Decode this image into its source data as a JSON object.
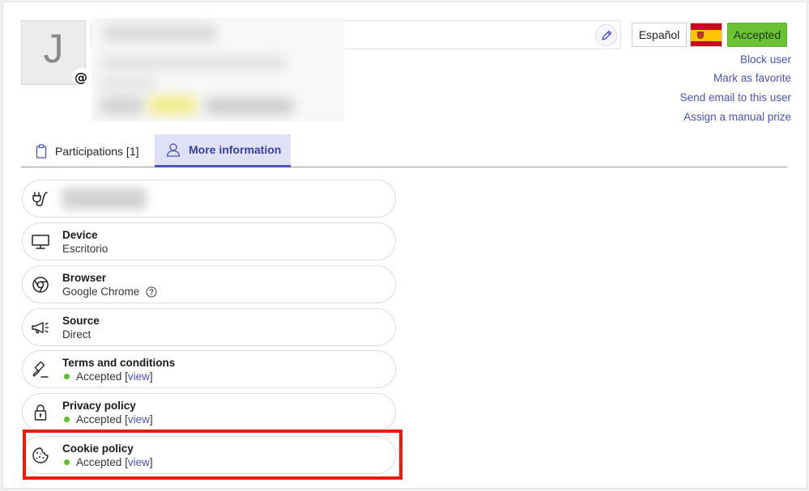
{
  "user": {
    "avatar_letter": "J",
    "badge": "@"
  },
  "header": {
    "language_button": "Español",
    "flag_icon": "spain-flag-icon",
    "status_button": "Accepted",
    "status_color": "#6cc235"
  },
  "actions": {
    "block_user": "Block user",
    "mark_favorite": "Mark as favorite",
    "send_email": "Send email to this user",
    "assign_prize": "Assign a manual prize"
  },
  "tabs": [
    {
      "label": "Participations [1]",
      "icon": "clipboard-icon",
      "active": false
    },
    {
      "label": "More information",
      "icon": "user-icon",
      "active": true
    }
  ],
  "info": {
    "connection": {
      "icon": "plug-icon",
      "value": ""
    },
    "device": {
      "title": "Device",
      "value": "Escritorio",
      "icon": "monitor-icon"
    },
    "browser": {
      "title": "Browser",
      "value": "Google Chrome",
      "icon": "chrome-icon"
    },
    "source": {
      "title": "Source",
      "value": "Direct",
      "icon": "megaphone-icon"
    },
    "terms": {
      "title": "Terms and conditions",
      "status": "Accepted",
      "link_open": "[",
      "link": "view",
      "link_close": "]",
      "icon": "gavel-icon"
    },
    "privacy": {
      "title": "Privacy policy",
      "status": "Accepted",
      "link_open": "[",
      "link": "view",
      "link_close": "]",
      "icon": "lock-icon"
    },
    "cookie": {
      "title": "Cookie policy",
      "status": "Accepted",
      "link_open": "[",
      "link": "view",
      "link_close": "]",
      "icon": "cookie-icon"
    }
  },
  "colors": {
    "accent": "#4b52b8",
    "accepted_dot": "#5cbf2a",
    "highlight_border": "#f01a0a"
  }
}
